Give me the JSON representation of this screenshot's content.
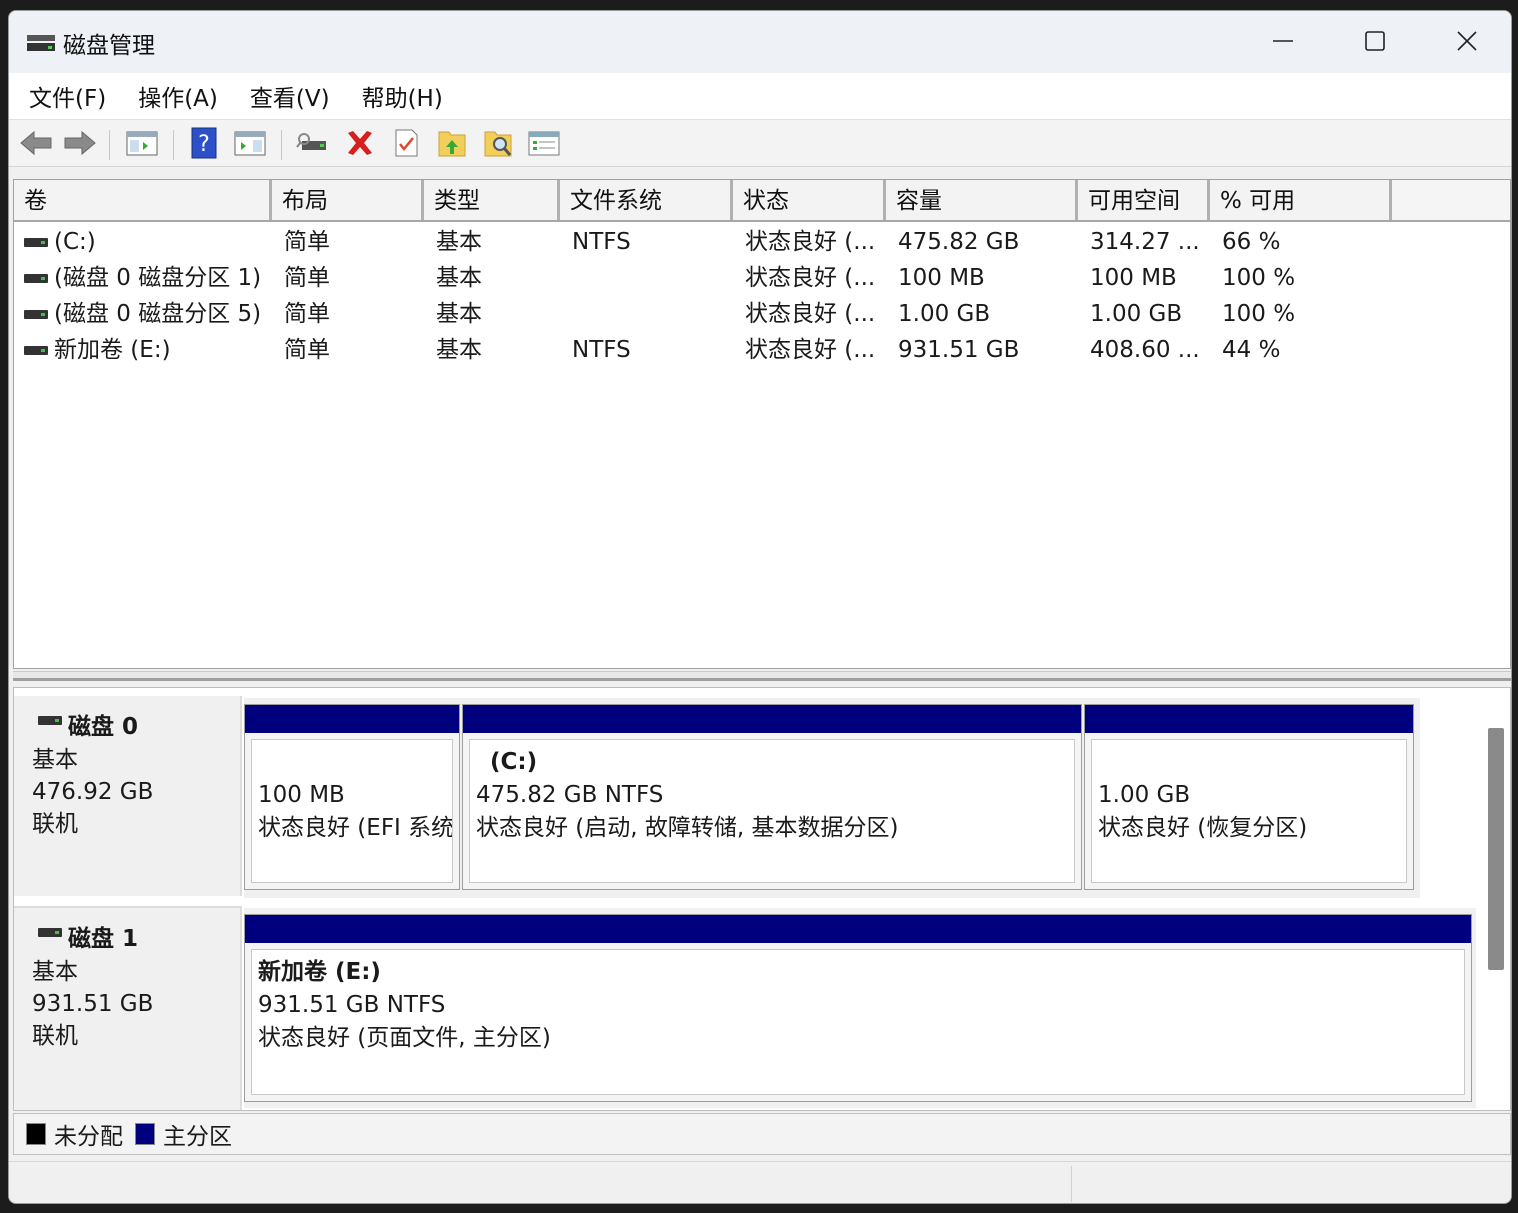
{
  "window": {
    "title": "磁盘管理"
  },
  "menu": [
    "文件(F)",
    "操作(A)",
    "查看(V)",
    "帮助(H)"
  ],
  "toolbar": {
    "icons": [
      "back-icon",
      "forward-icon",
      "console-tree-icon",
      "help-icon",
      "action-pane-icon",
      "connect-disk-icon",
      "delete-icon",
      "properties-icon",
      "folder-up-icon",
      "folder-search-icon",
      "list-view-icon"
    ]
  },
  "volume_list": {
    "columns": [
      "卷",
      "布局",
      "类型",
      "文件系统",
      "状态",
      "容量",
      "可用空间",
      "% 可用"
    ],
    "rows": [
      {
        "volume": " (C:)",
        "layout": "简单",
        "type": "基本",
        "fs": "NTFS",
        "status": "状态良好 (...",
        "capacity": "475.82 GB",
        "free": "314.27 ...",
        "pct": "66 %"
      },
      {
        "volume": "(磁盘 0 磁盘分区 1)",
        "layout": "简单",
        "type": "基本",
        "fs": "",
        "status": "状态良好 (...",
        "capacity": "100 MB",
        "free": "100 MB",
        "pct": "100 %"
      },
      {
        "volume": "(磁盘 0 磁盘分区 5)",
        "layout": "简单",
        "type": "基本",
        "fs": "",
        "status": "状态良好 (...",
        "capacity": "1.00 GB",
        "free": "1.00 GB",
        "pct": "100 %"
      },
      {
        "volume": "新加卷 (E:)",
        "layout": "简单",
        "type": "基本",
        "fs": "NTFS",
        "status": "状态良好 (...",
        "capacity": "931.51 GB",
        "free": "408.60 ...",
        "pct": "44 %"
      }
    ]
  },
  "disks": [
    {
      "name": "磁盘 0",
      "kind": "基本",
      "size": "476.92 GB",
      "state": "联机",
      "partitions": [
        {
          "title": "",
          "line1": "100 MB",
          "line2": "状态良好 (EFI 系统分区)"
        },
        {
          "title": "(C:)",
          "line1": "475.82 GB NTFS",
          "line2": "状态良好 (启动, 故障转储, 基本数据分区)"
        },
        {
          "title": "",
          "line1": "1.00 GB",
          "line2": "状态良好 (恢复分区)"
        }
      ]
    },
    {
      "name": "磁盘 1",
      "kind": "基本",
      "size": "931.51 GB",
      "state": "联机",
      "partitions": [
        {
          "title": "新加卷  (E:)",
          "line1": "931.51 GB NTFS",
          "line2": "状态良好 (页面文件, 主分区)"
        }
      ]
    }
  ],
  "legend": [
    {
      "label": "未分配",
      "color": "#000000"
    },
    {
      "label": "主分区",
      "color": "#00007f"
    }
  ]
}
